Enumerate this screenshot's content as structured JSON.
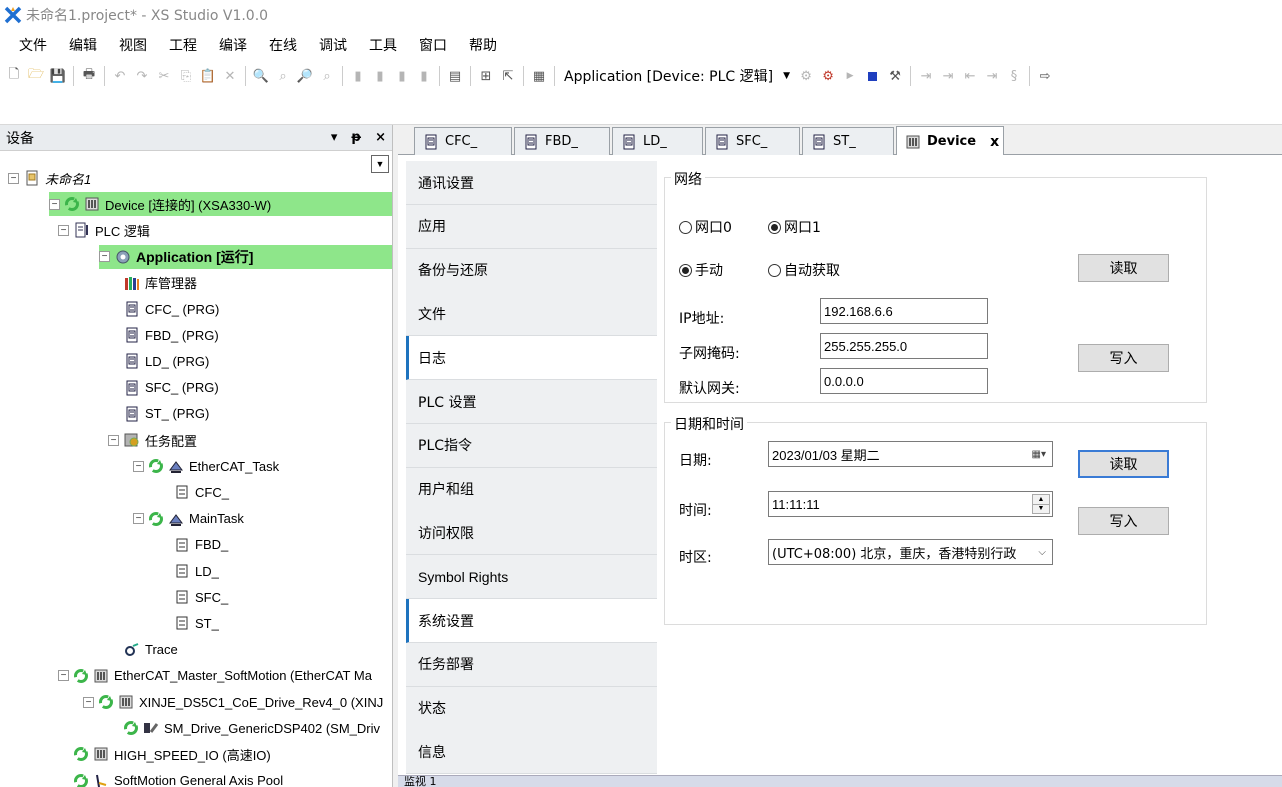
{
  "window": {
    "title": "未命名1.project* - XS Studio V1.0.0"
  },
  "menu": [
    "文件",
    "编辑",
    "视图",
    "工程",
    "编译",
    "在线",
    "调试",
    "工具",
    "窗口",
    "帮助"
  ],
  "toolbar": {
    "active_application": "Application [Device: PLC 逻辑]"
  },
  "device_panel": {
    "title": "设备",
    "pin_label": "▾",
    "dock_label": "ᵖ",
    "close_label": "×",
    "tree": [
      {
        "label": "未命名1",
        "level": 0,
        "icon": "project-icon",
        "expand": "−",
        "style": "italic"
      },
      {
        "label": "Device [连接的] (XSA330-W)",
        "level": 1,
        "icon": "device-icon",
        "expand": "−",
        "sync": true,
        "highlight": true
      },
      {
        "label": "PLC 逻辑",
        "level": 2,
        "icon": "plc-logic-icon",
        "expand": "−"
      },
      {
        "label": "Application [运行]",
        "level": 3,
        "icon": "application-gear-icon",
        "expand": "−",
        "highlight": true,
        "style": "bold"
      },
      {
        "label": "库管理器",
        "level": 4,
        "icon": "library-manager-icon"
      },
      {
        "label": "CFC_ (PRG)",
        "level": 4,
        "icon": "cfc-icon"
      },
      {
        "label": "FBD_ (PRG)",
        "level": 4,
        "icon": "fbd-icon"
      },
      {
        "label": "LD_ (PRG)",
        "level": 4,
        "icon": "ld-icon"
      },
      {
        "label": "SFC_ (PRG)",
        "level": 4,
        "icon": "sfc-icon"
      },
      {
        "label": "ST_ (PRG)",
        "level": 4,
        "icon": "st-icon"
      },
      {
        "label": "任务配置",
        "level": 4,
        "icon": "task-config-icon",
        "expand": "−"
      },
      {
        "label": "EtherCAT_Task",
        "level": 5,
        "icon": "task-icon",
        "expand": "−",
        "sync": true
      },
      {
        "label": "CFC_",
        "level": 6,
        "icon": "pou-call-icon"
      },
      {
        "label": "MainTask",
        "level": 5,
        "icon": "task-icon",
        "expand": "−",
        "sync": true
      },
      {
        "label": "FBD_",
        "level": 6,
        "icon": "pou-call-icon"
      },
      {
        "label": "LD_",
        "level": 6,
        "icon": "pou-call-icon"
      },
      {
        "label": "SFC_",
        "level": 6,
        "icon": "pou-call-icon"
      },
      {
        "label": "ST_",
        "level": 6,
        "icon": "pou-call-icon"
      },
      {
        "label": "Trace",
        "level": 4,
        "icon": "trace-icon"
      },
      {
        "label": "EtherCAT_Master_SoftMotion (EtherCAT Ma",
        "level": 2,
        "icon": "device-icon",
        "expand": "−",
        "sync": true
      },
      {
        "label": "XINJE_DS5C1_CoE_Drive_Rev4_0 (XINJ",
        "level": 3,
        "icon": "device-icon",
        "expand": "−",
        "sync": true
      },
      {
        "label": "SM_Drive_GenericDSP402 (SM_Driv",
        "level": 4,
        "icon": "axis-drive-icon",
        "sync": true
      },
      {
        "label": "HIGH_SPEED_IO (高速IO)",
        "level": 2,
        "icon": "device-icon",
        "sync": true
      },
      {
        "label": "SoftMotion General Axis Pool",
        "level": 2,
        "icon": "axis-pool-icon",
        "sync": true
      }
    ]
  },
  "tabs": [
    {
      "label": "CFC_",
      "icon": "cfc-icon"
    },
    {
      "label": "FBD_",
      "icon": "fbd-icon"
    },
    {
      "label": "LD_",
      "icon": "ld-icon"
    },
    {
      "label": "SFC_",
      "icon": "sfc-icon"
    },
    {
      "label": "ST_",
      "icon": "st-icon"
    },
    {
      "label": "Device",
      "icon": "device-icon",
      "active": true,
      "close": "x"
    }
  ],
  "nav": [
    {
      "label": "通讯设置"
    },
    {
      "label": "应用"
    },
    {
      "label": "备份与还原"
    },
    {
      "label": "文件"
    },
    {
      "label": "日志",
      "active": true
    },
    {
      "label": "PLC 设置"
    },
    {
      "label": "PLC指令"
    },
    {
      "label": "用户和组"
    },
    {
      "label": "访问权限"
    },
    {
      "label": "Symbol Rights",
      "latin": true
    },
    {
      "label": "系统设置",
      "active": true
    },
    {
      "label": "任务部署"
    },
    {
      "label": "状态"
    },
    {
      "label": "信息"
    }
  ],
  "network": {
    "title": "网络",
    "port0": "网口0",
    "port1": "网口1",
    "manual": "手动",
    "auto": "自动获取",
    "read_button": "读取",
    "write_button": "写入",
    "ip_label": "IP地址:",
    "ip_value": "192.168.6.6",
    "mask_label": "子网掩码:",
    "mask_value": "255.255.255.0",
    "gateway_label": "默认网关:",
    "gateway_value": "0.0.0.0"
  },
  "datetime": {
    "title": "日期和时间",
    "date_label": "日期:",
    "date_value": "2023/01/03 星期二",
    "time_label": "时间:",
    "time_value": "11:11:11",
    "tz_label": "时区:",
    "tz_value": "(UTC+08:00) 北京，重庆，香港特别行政",
    "read_button": "读取",
    "write_button": "写入"
  },
  "bottom_bar": {
    "label": "监视 1"
  },
  "colors": {
    "highlight": "#8ee68a",
    "accent": "#1e73be",
    "sync": "#3cb54a"
  }
}
